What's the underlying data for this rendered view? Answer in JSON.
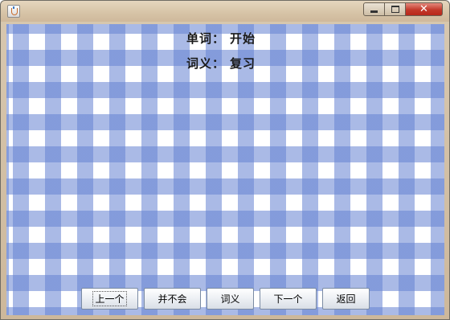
{
  "window": {
    "controls": {
      "minimize_icon": "minimize-icon",
      "maximize_icon": "maximize-icon",
      "close_icon": "close-icon"
    },
    "close_glyph": "✕"
  },
  "content": {
    "word_label": "单词：",
    "word_value": "开始",
    "meaning_label": "词义：",
    "meaning_value": "复习",
    "background": {
      "pattern": "gingham",
      "colors": [
        "#ffffff",
        "#a9b9e8",
        "#6f8fd8"
      ]
    }
  },
  "buttons": {
    "prev": "上一个",
    "dont_know": "并不会",
    "meaning": "词义",
    "next": "下一个",
    "back": "返回"
  }
}
